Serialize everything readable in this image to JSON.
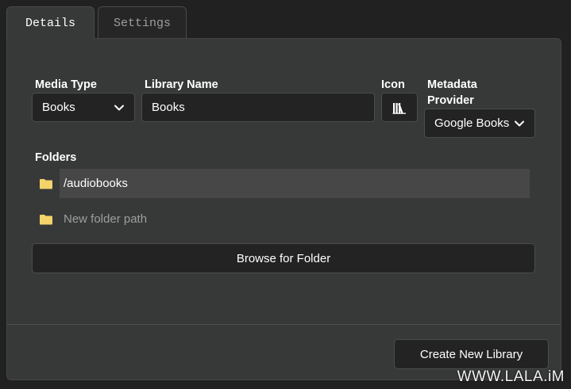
{
  "tabs": [
    {
      "label": "Details"
    },
    {
      "label": "Settings"
    }
  ],
  "form": {
    "media_type_label": "Media Type",
    "media_type_value": "Books",
    "library_name_label": "Library Name",
    "library_name_value": "Books",
    "icon_label": "Icon",
    "icon_value": "books-icon",
    "metadata_provider_label": "Metadata Provider",
    "metadata_provider_value": "Google Books"
  },
  "folders": {
    "label": "Folders",
    "items": [
      "/audiobooks"
    ],
    "new_placeholder": "New folder path",
    "browse_label": "Browse for Folder"
  },
  "footer": {
    "create_label": "Create New Library"
  },
  "watermark": "WWW.LALA.iM",
  "colors": {
    "background": "#212121",
    "panel": "#373838",
    "input": "#232323",
    "folder_icon": "#f5d36b",
    "muted_text": "#9e9e9e"
  }
}
